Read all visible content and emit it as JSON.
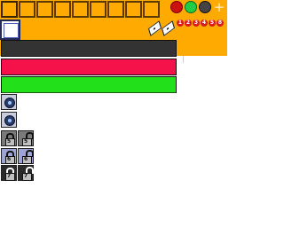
{
  "toolbar": {
    "slot_count": 10,
    "color_buttons": [
      {
        "name": "red",
        "color": "#cc1111"
      },
      {
        "name": "green",
        "color": "#22cc44"
      },
      {
        "name": "dark-grey",
        "color": "#444444"
      }
    ],
    "plus_label": "+",
    "numbers": [
      "1",
      "2",
      "3",
      "4",
      "5",
      "8"
    ],
    "colors": {
      "background": "#ffaa00",
      "slot_border": "#5a3a00"
    }
  },
  "bars": [
    {
      "name": "dark-bar",
      "color": "#333333"
    },
    {
      "name": "red-bar",
      "color": "#f5124a"
    },
    {
      "name": "green-bar",
      "color": "#22e01a"
    }
  ],
  "side_icons": {
    "globe_count": 2,
    "locks": [
      {
        "row": 1,
        "style": "grey",
        "label": "5",
        "state": "locked"
      },
      {
        "row": 1,
        "style": "grey",
        "label": "5",
        "state": "unlocked"
      },
      {
        "row": 2,
        "style": "blue",
        "label": "6",
        "state": "locked"
      },
      {
        "row": 2,
        "style": "blue",
        "label": "6",
        "state": "unlocked"
      },
      {
        "row": 3,
        "style": "dark",
        "label": "7",
        "state": "locked"
      },
      {
        "row": 3,
        "style": "dark",
        "label": "7",
        "state": "unlocked"
      }
    ]
  }
}
